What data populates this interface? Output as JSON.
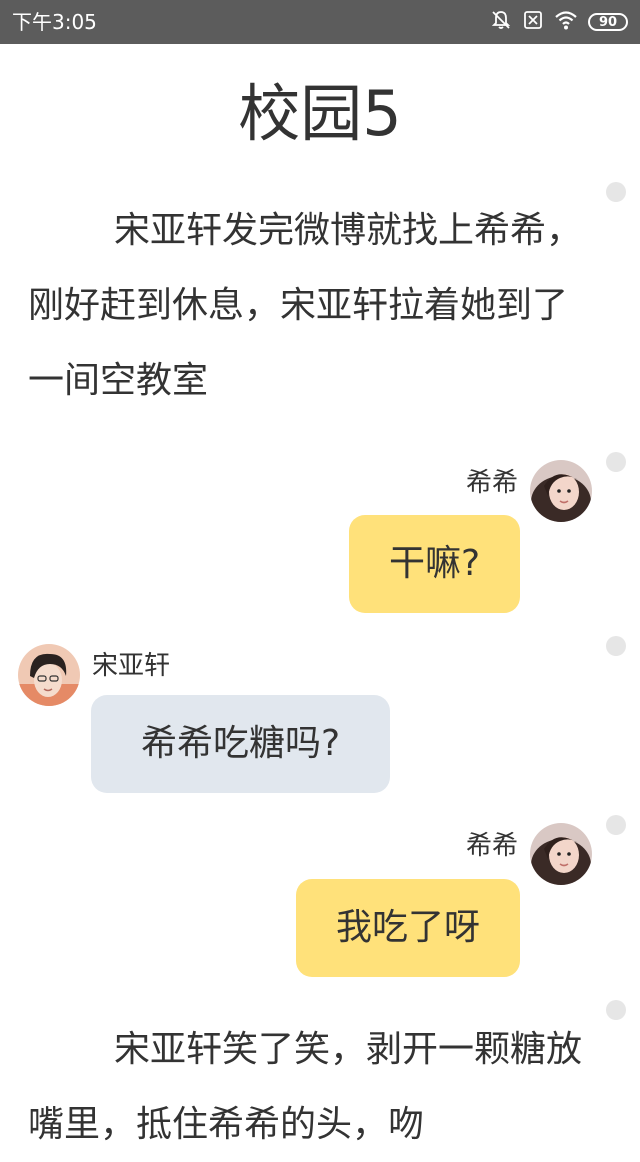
{
  "status_bar": {
    "time": "下午3:05",
    "battery": "90",
    "icons": [
      "bell-muted-icon",
      "sim-off-icon",
      "wifi-icon",
      "battery-icon"
    ]
  },
  "article": {
    "title": "校园5"
  },
  "story": [
    {
      "type": "narration",
      "text": "宋亚轩发完微博就找上希希，刚好赶到休息，宋亚轩拉着她到了一间空教室"
    },
    {
      "type": "message",
      "side": "right",
      "speaker": "希希",
      "text": "干嘛?"
    },
    {
      "type": "message",
      "side": "left",
      "speaker": "宋亚轩",
      "text": "希希吃糖吗?"
    },
    {
      "type": "message",
      "side": "right",
      "speaker": "希希",
      "text": "我吃了呀"
    },
    {
      "type": "narration",
      "text": "宋亚轩笑了笑，剥开一颗糖放嘴里，抵住希希的头，吻"
    }
  ],
  "colors": {
    "status_bar": "#5c5c5c",
    "bubble_self": "#ffe17a",
    "bubble_other": "#e1e7ee",
    "text": "#333333",
    "dot": "#e6e6e6"
  }
}
